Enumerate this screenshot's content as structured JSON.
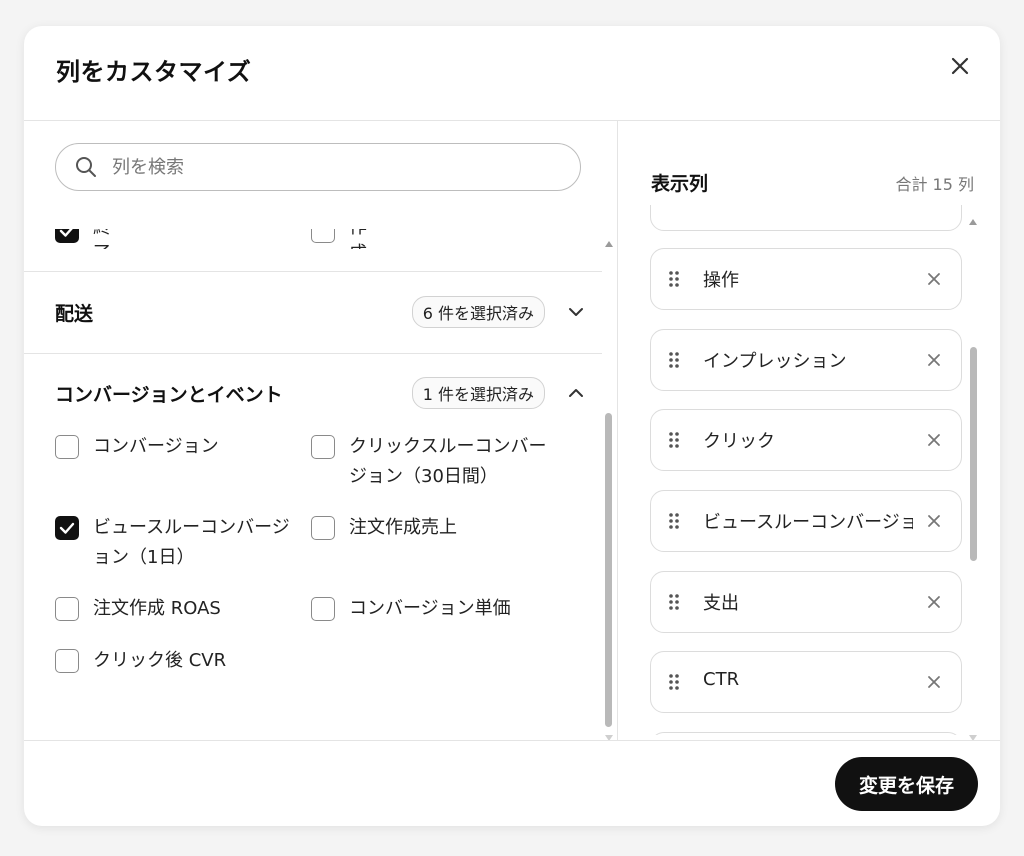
{
  "dialog": {
    "title": "列をカスタマイズ",
    "close_icon": "close-icon"
  },
  "left": {
    "search": {
      "placeholder": "列を検索",
      "value": ""
    },
    "clipped_row": [
      {
        "label": "終了日",
        "checked": true
      },
      {
        "label": "作成日",
        "checked": false
      }
    ],
    "sections": [
      {
        "title": "配送",
        "badge": "6 件を選択済み",
        "expanded": false
      },
      {
        "title": "コンバージョンとイベント",
        "badge": "1 件を選択済み",
        "expanded": true
      }
    ],
    "options": [
      {
        "label": "コンバージョン",
        "checked": false
      },
      {
        "label": "クリックスルーコンバージョン（30日間）",
        "label_lines": [
          "クリックスルーコンバー",
          "ジョン（30日間）"
        ],
        "checked": false
      },
      {
        "label": "ビュースルーコンバージョン（1日）",
        "label_lines": [
          "ビュースルーコンバージ",
          "ョン（1日）"
        ],
        "checked": true
      },
      {
        "label": "注文作成売上",
        "checked": false
      },
      {
        "label": "注文作成 ROAS",
        "checked": false
      },
      {
        "label": "コンバージョン単価",
        "checked": false
      },
      {
        "label": "クリック後 CVR",
        "checked": false
      }
    ]
  },
  "right": {
    "title": "表示列",
    "total": "合計 15 列",
    "columns": [
      {
        "label": "操作"
      },
      {
        "label": "インプレッション"
      },
      {
        "label": "クリック"
      },
      {
        "label": "ビュースルーコンバージョン（..."
      },
      {
        "label": "支出"
      },
      {
        "label": "CTR"
      }
    ]
  },
  "footer": {
    "save_label": "変更を保存"
  }
}
